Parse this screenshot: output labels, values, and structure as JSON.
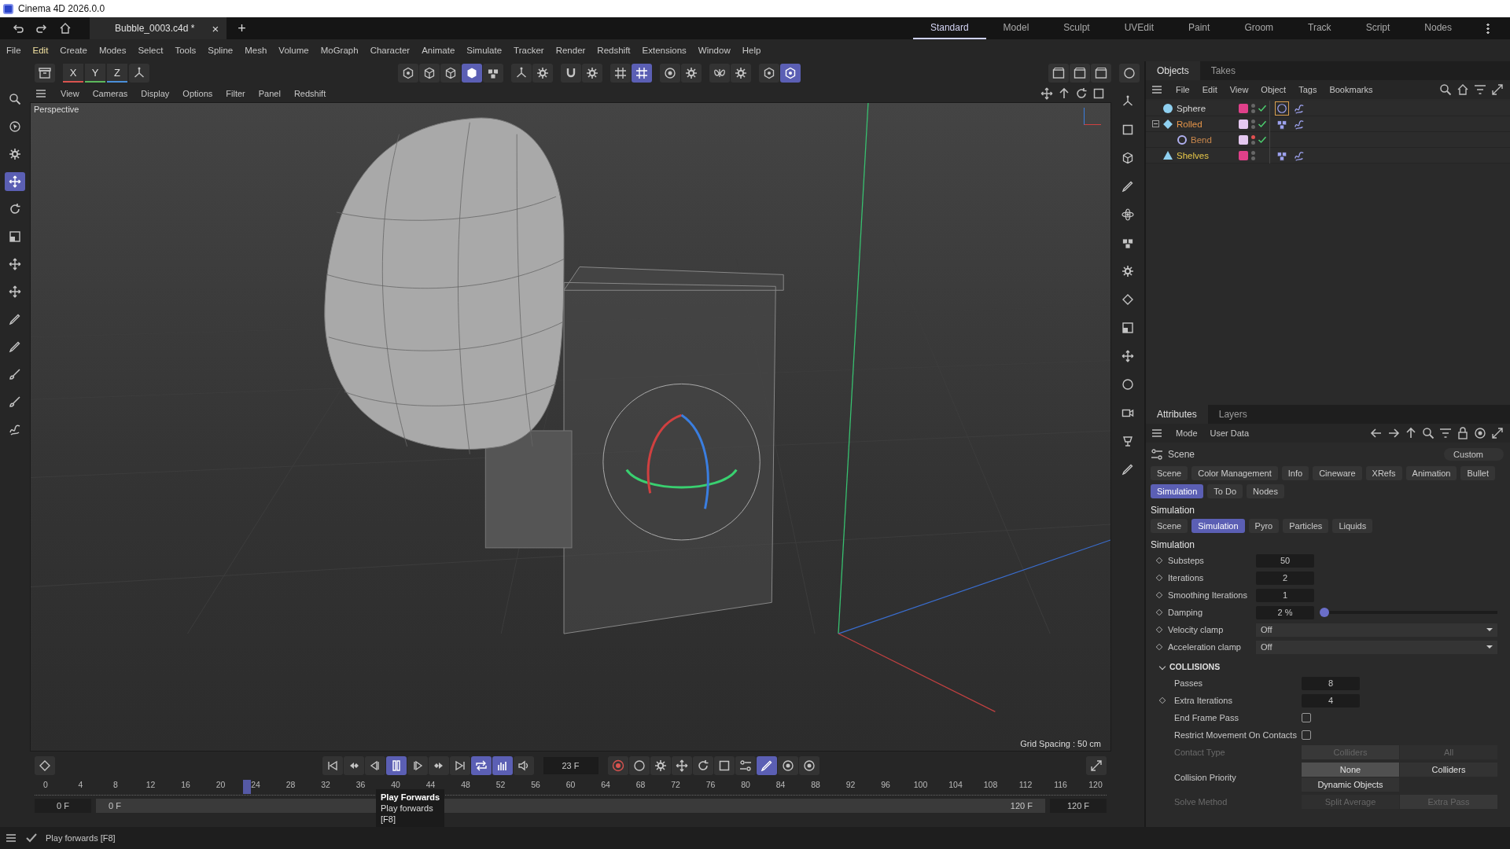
{
  "window": {
    "title": "Cinema 4D 2026.0.0"
  },
  "doc_tabs": [
    {
      "label": "Bubble_0003.c4d *",
      "selected": true,
      "close": "×"
    }
  ],
  "new_tab": "+",
  "layouts": [
    {
      "label": "Standard",
      "selected": true
    },
    {
      "label": "Model",
      "selected": false
    },
    {
      "label": "Sculpt",
      "selected": false
    },
    {
      "label": "UVEdit",
      "selected": false
    },
    {
      "label": "Paint",
      "selected": false
    },
    {
      "label": "Groom",
      "selected": false
    },
    {
      "label": "Track",
      "selected": false
    },
    {
      "label": "Script",
      "selected": false
    },
    {
      "label": "Nodes",
      "selected": false
    }
  ],
  "menu": [
    {
      "label": "File",
      "selected": false
    },
    {
      "label": "Edit",
      "selected": true
    },
    {
      "label": "Create",
      "selected": false
    },
    {
      "label": "Modes",
      "selected": false
    },
    {
      "label": "Select",
      "selected": false
    },
    {
      "label": "Tools",
      "selected": false
    },
    {
      "label": "Spline",
      "selected": false
    },
    {
      "label": "Mesh",
      "selected": false
    },
    {
      "label": "Volume",
      "selected": false
    },
    {
      "label": "MoGraph",
      "selected": false
    },
    {
      "label": "Character",
      "selected": false
    },
    {
      "label": "Animate",
      "selected": false
    },
    {
      "label": "Simulate",
      "selected": false
    },
    {
      "label": "Tracker",
      "selected": false
    },
    {
      "label": "Render",
      "selected": false
    },
    {
      "label": "Redshift",
      "selected": false
    },
    {
      "label": "Extensions",
      "selected": false
    },
    {
      "label": "Window",
      "selected": false
    },
    {
      "label": "Help",
      "selected": false
    }
  ],
  "axis_buttons": [
    {
      "label": "X",
      "color": "#d9534f"
    },
    {
      "label": "Y",
      "color": "#5cb85c"
    },
    {
      "label": "Z",
      "color": "#4a8fd9"
    }
  ],
  "toolbar": [
    {
      "on": false
    },
    {
      "on": false
    },
    {
      "on": false
    },
    {
      "on": true
    },
    {
      "on": false
    },
    {
      "on": false
    },
    {
      "on": false
    },
    {
      "on": false
    },
    {
      "on": false
    },
    {
      "on": false
    },
    {
      "on": true
    },
    {
      "on": false
    },
    {
      "on": false
    },
    {
      "on": false
    },
    {
      "on": false
    },
    {
      "on": false
    },
    {
      "on": true
    }
  ],
  "tools": [
    {
      "on": false
    },
    {
      "on": false
    },
    {
      "on": false
    },
    {
      "on": true
    },
    {
      "on": false
    },
    {
      "on": false
    },
    {
      "on": false
    },
    {
      "on": false
    },
    {
      "on": false
    },
    {
      "on": false
    },
    {
      "on": false
    },
    {
      "on": false
    },
    {
      "on": false
    }
  ],
  "viewport": {
    "menu": [
      "View",
      "Cameras",
      "Display",
      "Options",
      "Filter",
      "Panel",
      "Redshift"
    ],
    "camera": "Perspective",
    "grid_spacing": "Grid Spacing : 50 cm"
  },
  "objects_panel": {
    "tabs": [
      {
        "label": "Objects",
        "selected": true
      },
      {
        "label": "Takes",
        "selected": false
      }
    ],
    "menu": [
      "File",
      "Edit",
      "View",
      "Object",
      "Tags",
      "Bookmarks"
    ],
    "tree": [
      {
        "name": "Sphere",
        "kind": "sphere",
        "color": "#e0408a",
        "editor_visible": true,
        "enabled": true,
        "tags": [
          {
            "kind": "material",
            "selected": true
          },
          {
            "kind": "flag",
            "selected": false
          }
        ]
      },
      {
        "name": "Rolled",
        "kind": "diamond",
        "color": "#e4c8f0",
        "editor_visible": true,
        "enabled": true,
        "expanded": true,
        "tags": [
          {
            "kind": "stack",
            "selected": false
          },
          {
            "kind": "flag",
            "selected": false
          }
        ],
        "children": [
          {
            "name": "Bend",
            "kind": "ring",
            "color": "#e4c8f0",
            "editor_visible": false,
            "enabled": true
          }
        ]
      },
      {
        "name": "Shelves",
        "kind": "triangle",
        "color": "#e0408a",
        "editor_visible": true,
        "enabled": false,
        "tags": [
          {
            "kind": "stack",
            "selected": false
          },
          {
            "kind": "flag",
            "selected": false
          }
        ]
      }
    ]
  },
  "attributes": {
    "tabs": [
      {
        "label": "Attributes",
        "selected": true
      },
      {
        "label": "Layers",
        "selected": false
      }
    ],
    "menu": [
      "Mode",
      "User Data"
    ],
    "breadcrumb": "Scene",
    "preset": "Custom",
    "page_tabs": [
      {
        "label": "Scene",
        "selected": false
      },
      {
        "label": "Color Management",
        "selected": false
      },
      {
        "label": "Info",
        "selected": false
      },
      {
        "label": "Cineware",
        "selected": false
      },
      {
        "label": "XRefs",
        "selected": false
      },
      {
        "label": "Animation",
        "selected": false
      },
      {
        "label": "Bullet",
        "selected": false
      },
      {
        "label": "Simulation",
        "selected": true
      },
      {
        "label": "To Do",
        "selected": false
      },
      {
        "label": "Nodes",
        "selected": false
      }
    ],
    "section": "Simulation",
    "sub_tabs": [
      {
        "label": "Scene",
        "selected": false
      },
      {
        "label": "Simulation",
        "selected": true
      },
      {
        "label": "Pyro",
        "selected": false
      },
      {
        "label": "Particles",
        "selected": false
      },
      {
        "label": "Liquids",
        "selected": false
      }
    ],
    "subsection": "Simulation",
    "fields": [
      {
        "kind": "number",
        "label": "Substeps",
        "value": "50",
        "keyframe": true
      },
      {
        "kind": "number",
        "label": "Iterations",
        "value": "2",
        "keyframe": true
      },
      {
        "kind": "number",
        "label": "Smoothing Iterations",
        "value": "1",
        "keyframe": true
      },
      {
        "kind": "slider",
        "label": "Damping",
        "value": "2 %",
        "keyframe": true,
        "level": 0.02
      },
      {
        "kind": "dropdown",
        "label": "Velocity clamp",
        "value": "Off",
        "keyframe": true
      },
      {
        "kind": "dropdown",
        "label": "Acceleration clamp",
        "value": "Off",
        "keyframe": true
      }
    ],
    "group": {
      "title": "COLLISIONS",
      "expanded": true,
      "fields": [
        {
          "kind": "number",
          "label": "Passes",
          "value": "8",
          "keyframe": false
        },
        {
          "kind": "number",
          "label": "Extra Iterations",
          "value": "4",
          "keyframe": true
        },
        {
          "kind": "checkbox",
          "label": "End Frame Pass",
          "checked": false,
          "keyframe": false
        },
        {
          "kind": "checkbox",
          "label": "Restrict Movement On Contacts",
          "checked": false,
          "keyframe": false
        },
        {
          "kind": "choice",
          "label": "Contact Type",
          "disabled": true,
          "keyframe": false,
          "options": [
            {
              "label": "Colliders",
              "selected": true
            },
            {
              "label": "All",
              "selected": false
            }
          ]
        },
        {
          "kind": "choice",
          "label": "Collision Priority",
          "disabled": false,
          "keyframe": false,
          "options": [
            {
              "label": "None",
              "selected": true
            },
            {
              "label": "Colliders",
              "selected": false
            },
            {
              "label": "Dynamic Objects",
              "selected": false
            }
          ]
        },
        {
          "kind": "choice",
          "label": "Solve Method",
          "disabled": true,
          "keyframe": false,
          "options": [
            {
              "label": "Split Average",
              "selected": false
            },
            {
              "label": "Extra Pass",
              "selected": true
            }
          ]
        }
      ]
    }
  },
  "timeline": {
    "controls": [
      {
        "on": false
      },
      {
        "on": false
      },
      {
        "on": false
      },
      {
        "on": true
      },
      {
        "on": false
      },
      {
        "on": false
      },
      {
        "on": false
      },
      {
        "on": true
      },
      {
        "on": true
      },
      {
        "on": false
      }
    ],
    "frame": "23 F",
    "keys": [
      {
        "on": false
      },
      {
        "on": false
      },
      {
        "on": false
      },
      {
        "on": false
      },
      {
        "on": false
      },
      {
        "on": false
      },
      {
        "on": false
      },
      {
        "on": true
      },
      {
        "on": false
      },
      {
        "on": false
      }
    ],
    "ticks": [
      "0",
      "4",
      "8",
      "12",
      "16",
      "20",
      "24",
      "28",
      "32",
      "36",
      "40",
      "44",
      "48",
      "52",
      "56",
      "60",
      "64",
      "68",
      "72",
      "76",
      "80",
      "84",
      "88",
      "92",
      "96",
      "100",
      "104",
      "108",
      "112",
      "116",
      "120"
    ],
    "playhead": {
      "level": 0.192
    },
    "range": {
      "level": 1
    },
    "start_fields": [
      "0 F",
      "0 F"
    ],
    "end_fields": [
      "120 F",
      "120 F"
    ],
    "tooltip": {
      "title": "Play Forwards",
      "lines": [
        "Play forwards",
        "[F8]"
      ]
    }
  },
  "status_bar": {
    "text": "Play forwards [F8]"
  }
}
